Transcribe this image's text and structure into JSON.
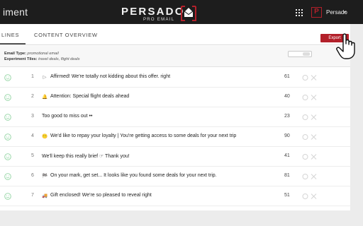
{
  "header": {
    "title": "iment",
    "logo_text": "PERSADO",
    "logo_subtext": "PRO EMAIL",
    "user_initial": "P",
    "user_name": "Persado",
    "user_caret": "▼"
  },
  "tabs": [
    {
      "label": "LINES",
      "active": true
    },
    {
      "label": "CONTENT OVERVIEW",
      "active": false
    }
  ],
  "export_label": "Export",
  "meta": {
    "email_type_label": "Email Type:",
    "email_type_value": "promotional email",
    "tiles_label": "Experiment Tiles:",
    "tiles_value": "travel deals, flight deals"
  },
  "rows": [
    {
      "num": "1",
      "glyph": "▷",
      "text": "Affirmed! We're totally not kidding about this offer. right",
      "score": "61"
    },
    {
      "num": "2",
      "glyph": "🔔",
      "text": "Attention: Special flight deals ahead",
      "score": "40"
    },
    {
      "num": "3",
      "glyph": "",
      "text": "Too good to miss out ••",
      "score": "23"
    },
    {
      "num": "4",
      "glyph": "😶",
      "text": "We'd like to repay your loyalty | You're getting access to some deals for your next trip",
      "score": "90"
    },
    {
      "num": "5",
      "glyph": "",
      "text": "We'll keep this really brief ☞ Thank you!",
      "score": "41"
    },
    {
      "num": "6",
      "glyph": "🏁",
      "text": "On your mark, get set... It looks like you found some deals for your next trip.",
      "score": "81"
    },
    {
      "num": "7",
      "glyph": "🚚",
      "text": "Gift enclosed! We're so pleased to reveal right",
      "score": "51"
    }
  ],
  "colors": {
    "accent": "#b3202a",
    "topbar": "#1d1d1d",
    "smile": "#8fd3a0"
  }
}
